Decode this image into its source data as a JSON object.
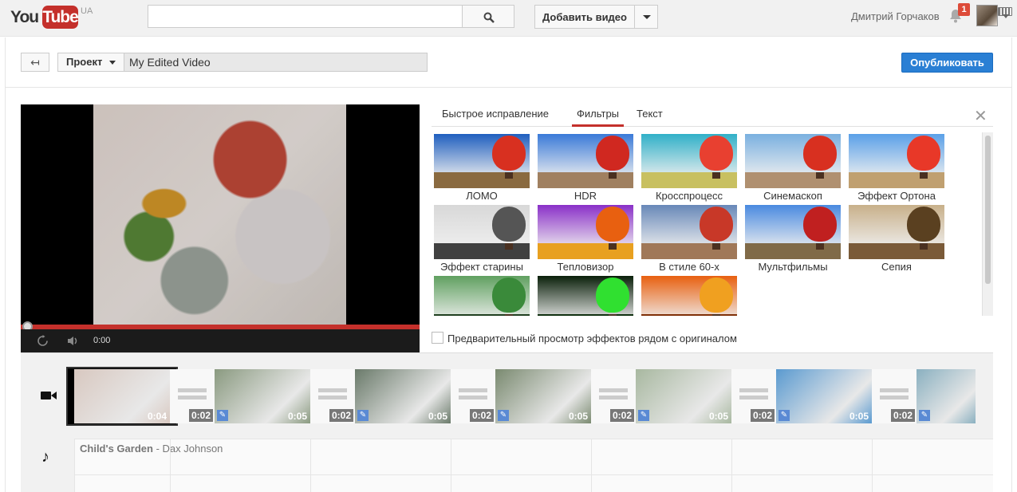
{
  "header": {
    "logo_you": "You",
    "logo_tube": "Tube",
    "region": "UA",
    "search_value": "",
    "upload_label": "Добавить видео",
    "username": "Дмитрий Горчаков",
    "notifications_count": "1"
  },
  "project": {
    "menu_label": "Проект",
    "title_value": "My Edited Video",
    "publish_label": "Опубликовать"
  },
  "player": {
    "time": "0:00",
    "progress": 0
  },
  "effects": {
    "tabs": [
      {
        "label": "Быстрое исправление",
        "active": false
      },
      {
        "label": "Фильтры",
        "active": true
      },
      {
        "label": "Текст",
        "active": false
      }
    ],
    "filters": [
      {
        "label": "ЛОМО",
        "sky": "#1f5fbf",
        "ground": "#8a6a40",
        "balloon": "#d83020"
      },
      {
        "label": "HDR",
        "sky": "#3a7ad8",
        "ground": "#a08060",
        "balloon": "#d02820"
      },
      {
        "label": "Кросспроцесс",
        "sky": "#30b0c8",
        "ground": "#c8c060",
        "balloon": "#e84030"
      },
      {
        "label": "Синемаскоп",
        "sky": "#7ab0e0",
        "ground": "#b09070",
        "balloon": "#d83020"
      },
      {
        "label": "Эффект Ортона",
        "sky": "#5aa0e8",
        "ground": "#c0a070",
        "balloon": "#e83828"
      },
      {
        "label": "Эффект старины",
        "sky": "#d8d8d8",
        "ground": "#404040",
        "balloon": "#555555"
      },
      {
        "label": "Тепловизор",
        "sky": "#8a30c8",
        "ground": "#e8a020",
        "balloon": "#e86010"
      },
      {
        "label": "В стиле 60-х",
        "sky": "#6888b8",
        "ground": "#a07858",
        "balloon": "#c83828"
      },
      {
        "label": "Мультфильмы",
        "sky": "#4a8ae0",
        "ground": "#806a48",
        "balloon": "#c02020"
      },
      {
        "label": "Сепия",
        "sky": "#c8b08a",
        "ground": "#7a5a38",
        "balloon": "#5a4020"
      },
      {
        "label": "",
        "sky": "#60a060",
        "ground": "#204020",
        "balloon": "#3a8a3a"
      },
      {
        "label": "",
        "sky": "#0a200a",
        "ground": "#103010",
        "balloon": "#30e030"
      },
      {
        "label": "",
        "sky": "#e86010",
        "ground": "#803008",
        "balloon": "#f0a020"
      }
    ],
    "compare_label": "Предварительный просмотр эффектов рядом с оригиналом",
    "compare_checked": false
  },
  "timeline": {
    "clips": [
      {
        "duration": "0:04",
        "color": "#d8c8c0"
      },
      {
        "duration": "0:05",
        "color": "#8a9a80"
      },
      {
        "duration": "0:05",
        "color": "#6a7a6a"
      },
      {
        "duration": "0:05",
        "color": "#7a8a70"
      },
      {
        "duration": "0:05",
        "color": "#a8b8a0"
      },
      {
        "duration": "0:05",
        "color": "#5a9ad0"
      },
      {
        "duration": "",
        "color": "#8ab0c0"
      }
    ],
    "transitions": [
      "0:02",
      "0:02",
      "0:02",
      "0:02",
      "0:02",
      "0:02"
    ],
    "audio_title": "Child's Garden",
    "audio_artist": "- Dax Johnson"
  }
}
